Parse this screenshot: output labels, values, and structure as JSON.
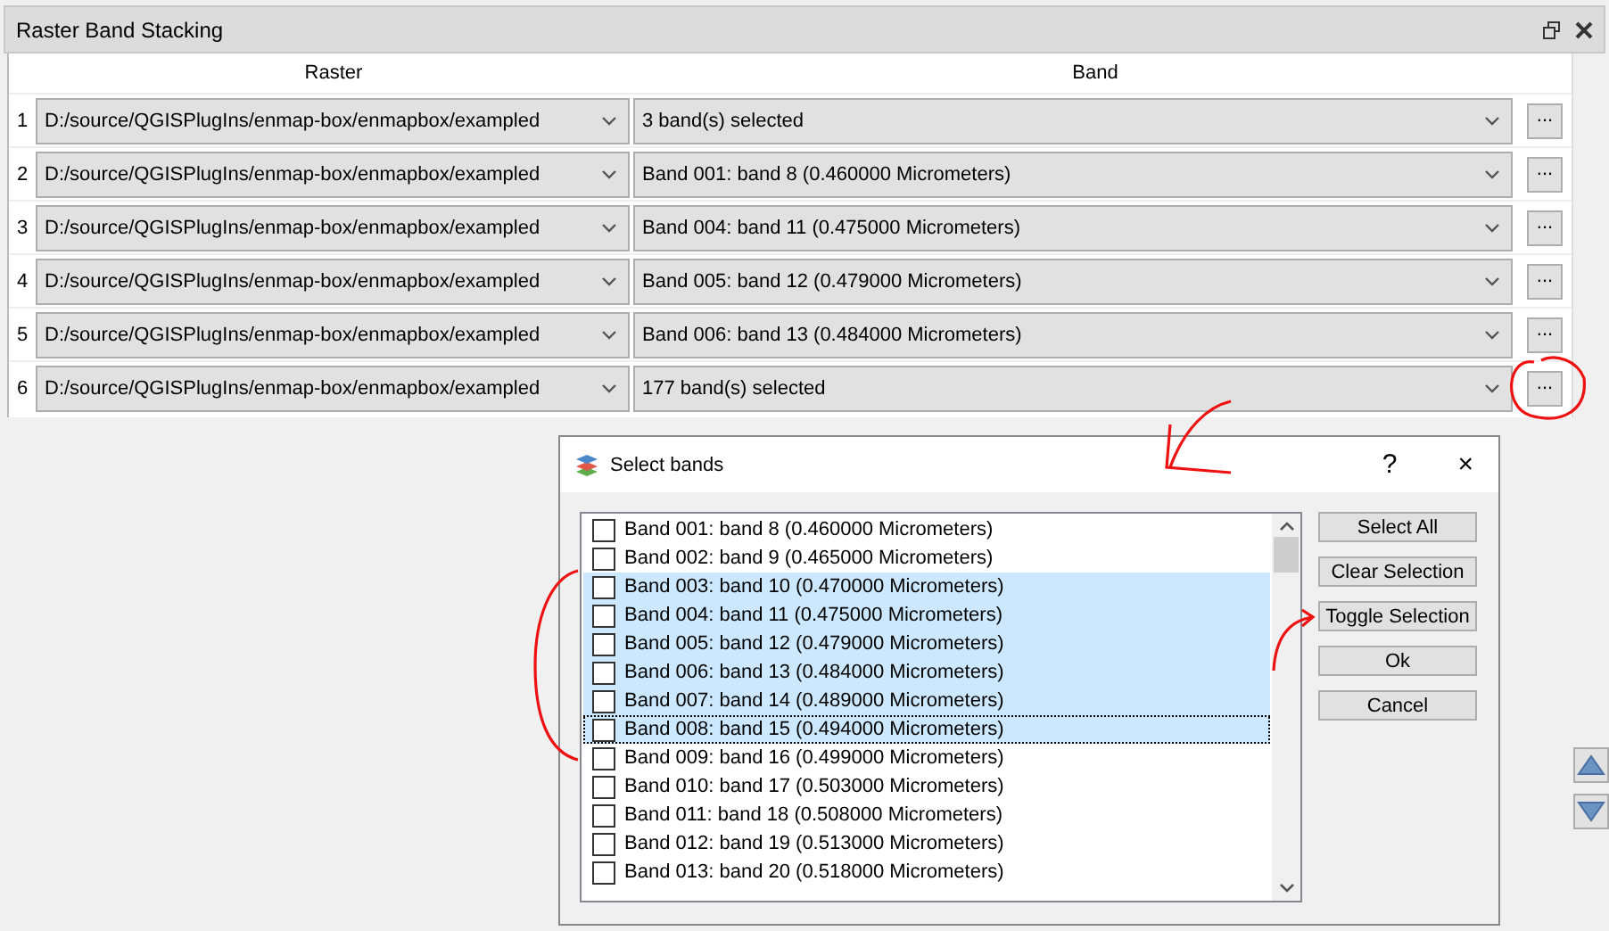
{
  "panel": {
    "title": "Raster Band Stacking"
  },
  "table": {
    "columns": [
      "Raster",
      "Band"
    ],
    "rows": [
      {
        "number": "1",
        "raster": "D:/source/QGISPlugIns/enmap-box/enmapbox/exampled",
        "band": "3 band(s) selected",
        "button": "..."
      },
      {
        "number": "2",
        "raster": "D:/source/QGISPlugIns/enmap-box/enmapbox/exampled",
        "band": "Band 001: band 8 (0.460000 Micrometers)",
        "button": "..."
      },
      {
        "number": "3",
        "raster": "D:/source/QGISPlugIns/enmap-box/enmapbox/exampled",
        "band": "Band 004: band 11 (0.475000 Micrometers)",
        "button": "..."
      },
      {
        "number": "4",
        "raster": "D:/source/QGISPlugIns/enmap-box/enmapbox/exampled",
        "band": "Band 005: band 12 (0.479000 Micrometers)",
        "button": "..."
      },
      {
        "number": "5",
        "raster": "D:/source/QGISPlugIns/enmap-box/enmapbox/exampled",
        "band": "Band 006: band 13 (0.484000 Micrometers)",
        "button": "..."
      },
      {
        "number": "6",
        "raster": "D:/source/QGISPlugIns/enmap-box/enmapbox/exampled",
        "band": "177 band(s) selected",
        "button": "..."
      }
    ]
  },
  "dialog": {
    "title": "Select bands",
    "help": "?",
    "close": "×",
    "items": [
      {
        "label": "Band 001: band 8 (0.460000 Micrometers)",
        "checked": false,
        "selected": false,
        "current": false
      },
      {
        "label": "Band 002: band 9 (0.465000 Micrometers)",
        "checked": false,
        "selected": false,
        "current": false
      },
      {
        "label": "Band 003: band 10 (0.470000 Micrometers)",
        "checked": false,
        "selected": true,
        "current": false
      },
      {
        "label": "Band 004: band 11 (0.475000 Micrometers)",
        "checked": false,
        "selected": true,
        "current": false
      },
      {
        "label": "Band 005: band 12 (0.479000 Micrometers)",
        "checked": false,
        "selected": true,
        "current": false
      },
      {
        "label": "Band 006: band 13 (0.484000 Micrometers)",
        "checked": false,
        "selected": true,
        "current": false
      },
      {
        "label": "Band 007: band 14 (0.489000 Micrometers)",
        "checked": false,
        "selected": true,
        "current": false
      },
      {
        "label": "Band 008: band 15 (0.494000 Micrometers)",
        "checked": false,
        "selected": true,
        "current": true
      },
      {
        "label": "Band 009: band 16 (0.499000 Micrometers)",
        "checked": false,
        "selected": false,
        "current": false
      },
      {
        "label": "Band 010: band 17 (0.503000 Micrometers)",
        "checked": false,
        "selected": false,
        "current": false
      },
      {
        "label": "Band 011: band 18 (0.508000 Micrometers)",
        "checked": false,
        "selected": false,
        "current": false
      },
      {
        "label": "Band 012: band 19 (0.513000 Micrometers)",
        "checked": false,
        "selected": false,
        "current": false
      },
      {
        "label": "Band 013: band 20 (0.518000 Micrometers)",
        "checked": false,
        "selected": false,
        "current": false
      }
    ],
    "buttons": [
      "Select All",
      "Clear Selection",
      "Toggle Selection",
      "Ok",
      "Cancel"
    ]
  }
}
